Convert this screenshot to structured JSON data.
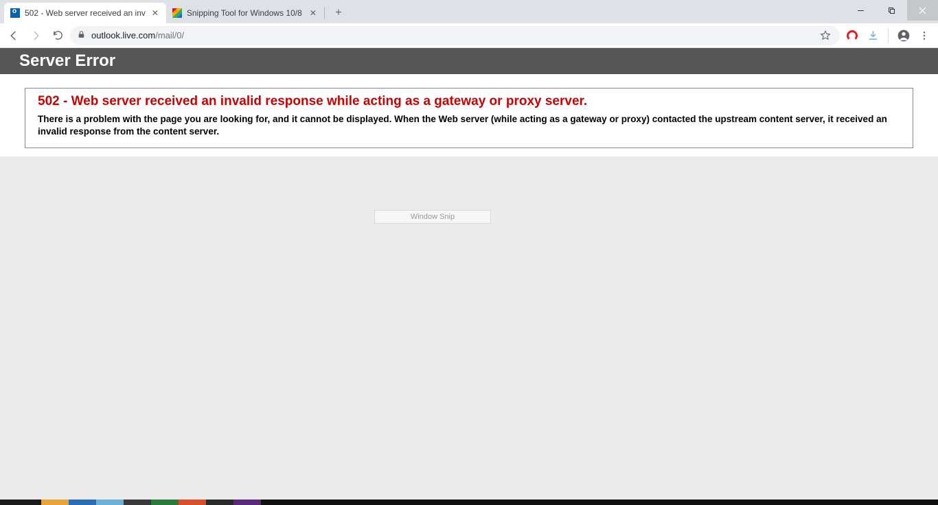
{
  "tabs": [
    {
      "title": "502 - Web server received an inv",
      "active": true
    },
    {
      "title": "Snipping Tool for Windows 10/8",
      "active": false
    }
  ],
  "url": {
    "host": "outlook.live.com",
    "path": "/mail/0/"
  },
  "page": {
    "header": "Server Error",
    "error_title": "502 - Web server received an invalid response while acting as a gateway or proxy server.",
    "error_desc": "There is a problem with the page you are looking for, and it cannot be displayed. When the Web server (while acting as a gateway or proxy) contacted the upstream content server, it received an invalid response from the content server."
  },
  "tooltip": "Window Snip"
}
